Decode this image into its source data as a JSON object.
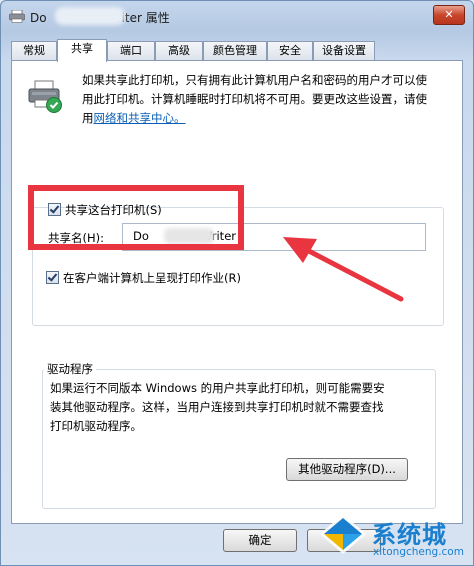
{
  "window": {
    "title_prefix": "Do",
    "title_suffix": "riter 属性",
    "close_glyph": "✕"
  },
  "tabs": [
    {
      "label": "常规"
    },
    {
      "label": "共享",
      "active": true
    },
    {
      "label": "端口"
    },
    {
      "label": "高级"
    },
    {
      "label": "颜色管理"
    },
    {
      "label": "安全"
    },
    {
      "label": "设备设置"
    }
  ],
  "sharing": {
    "info_line1": "如果共享此打印机，只有拥有此计算机用户名和密码的用户才可以使",
    "info_line2": "用此打印机。计算机睡眠时打印机将不可用。要更改这些设置，请使",
    "info_line3_prefix": "用",
    "info_link": "网络和共享中心。",
    "share_checkbox_label": "共享这台打印机(S)",
    "share_checked": true,
    "share_name_label": "共享名(H):",
    "share_name_prefix": "Do",
    "share_name_suffix": "Writer",
    "render_checkbox_label": "在客户端计算机上呈现打印作业(R)",
    "render_checked": true
  },
  "drivers": {
    "group_title": "驱动程序",
    "text_line1": "如果运行不同版本 Windows 的用户共享此打印机，则可能需要安",
    "text_line2": "装其他驱动程序。这样，当用户连接到共享打印机时就不需要查找",
    "text_line3": "打印机驱动程序。",
    "button_label": "其他驱动程序(D)..."
  },
  "footer": {
    "ok_label": "确定",
    "cancel_label": "取"
  },
  "watermark": {
    "text": "系统城",
    "url": "xitongcheng.com"
  },
  "colors": {
    "annotation_red": "#e8353f",
    "link_blue": "#0b5fb8"
  }
}
